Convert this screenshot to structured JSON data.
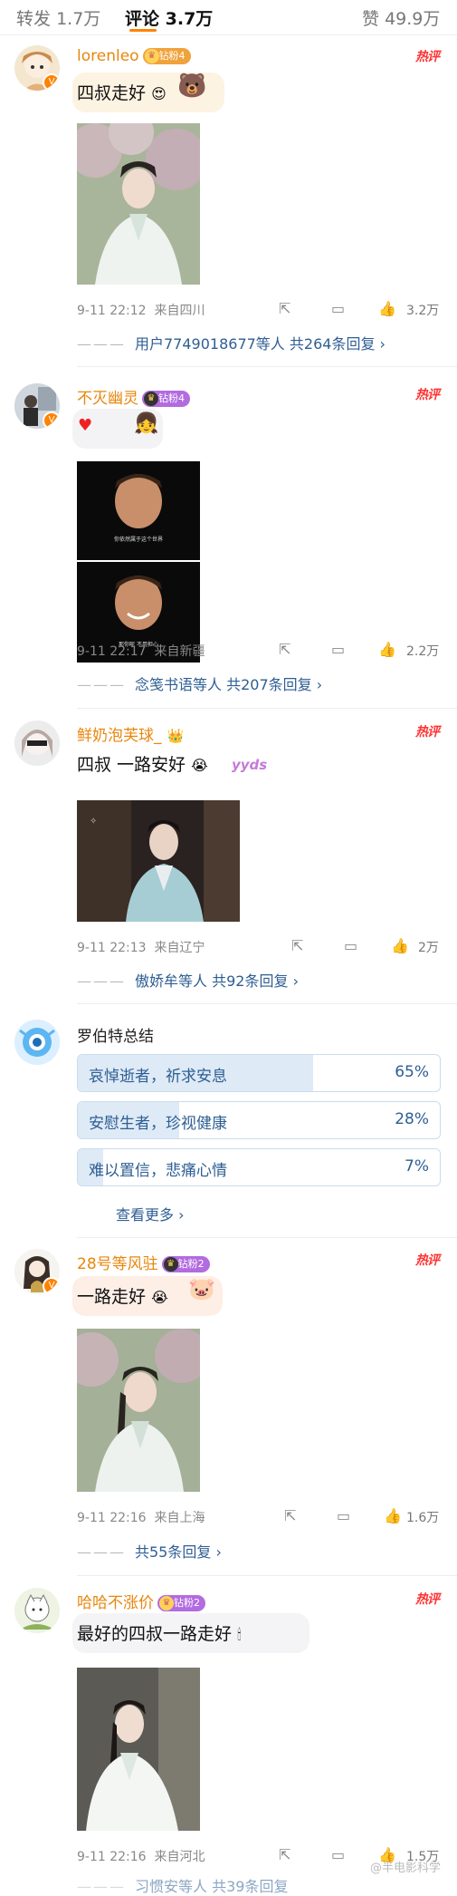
{
  "header": {
    "tabs": [
      {
        "label": "转发",
        "count": "1.7万"
      },
      {
        "label": "评论",
        "count": "3.7万"
      },
      {
        "label": "赞",
        "count": "49.9万"
      }
    ]
  },
  "hot_label": "热评",
  "comments": [
    {
      "user": "lorenleo",
      "badge": "钻粉4",
      "text": "四叔走好",
      "time": "9-11 22:12",
      "location": "来自四川",
      "likes": "3.2万",
      "reply_users": "用户7749018677等人",
      "reply_count": "共264条回复"
    },
    {
      "user": "不灭幽灵",
      "badge": "钻粉4",
      "text": "",
      "time": "9-11 22:17",
      "location": "来自新疆",
      "likes": "2.2万",
      "reply_users": "念笺书语等人",
      "reply_count": "共207条回复",
      "caption1": "你依然属于这个世界",
      "caption2": "那你呢 不用担心"
    },
    {
      "user": "鲜奶泡芙球_",
      "badge": "",
      "text": "四叔 一路安好",
      "time": "9-11 22:13",
      "location": "来自辽宁",
      "likes": "2万",
      "reply_users": "傲娇牟等人",
      "reply_count": "共92条回复",
      "sticker": "yyds"
    },
    {
      "user": "28号等风驻",
      "badge": "钻粉2",
      "text": "一路走好",
      "time": "9-11 22:16",
      "location": "来自上海",
      "likes": "1.6万",
      "reply_users": "",
      "reply_count": "共55条回复"
    },
    {
      "user": "哈哈不涨价",
      "badge": "钻粉2",
      "text": "最好的四叔一路走好",
      "time": "9-11 22:16",
      "location": "来自河北",
      "likes": "1.5万",
      "reply_users": "习惯安等人",
      "reply_count": "共39条回复"
    }
  ],
  "poll": {
    "user": "罗伯特总结",
    "options": [
      {
        "label": "哀悼逝者，祈求安息",
        "pct": "65%",
        "value": 0.65
      },
      {
        "label": "安慰生者，珍视健康",
        "pct": "28%",
        "value": 0.28
      },
      {
        "label": "难以置信，悲痛心情",
        "pct": "7%",
        "value": 0.07
      }
    ],
    "more": "查看更多"
  },
  "watermark": "@半电影科学",
  "colors": {
    "accent": "#ff8200",
    "link": "#2e5e93",
    "hot": "#ff3333",
    "username": "#e8860c"
  },
  "icons": [
    "share-icon",
    "comment-icon",
    "like-icon",
    "chevron-right-icon",
    "verified-icon"
  ]
}
